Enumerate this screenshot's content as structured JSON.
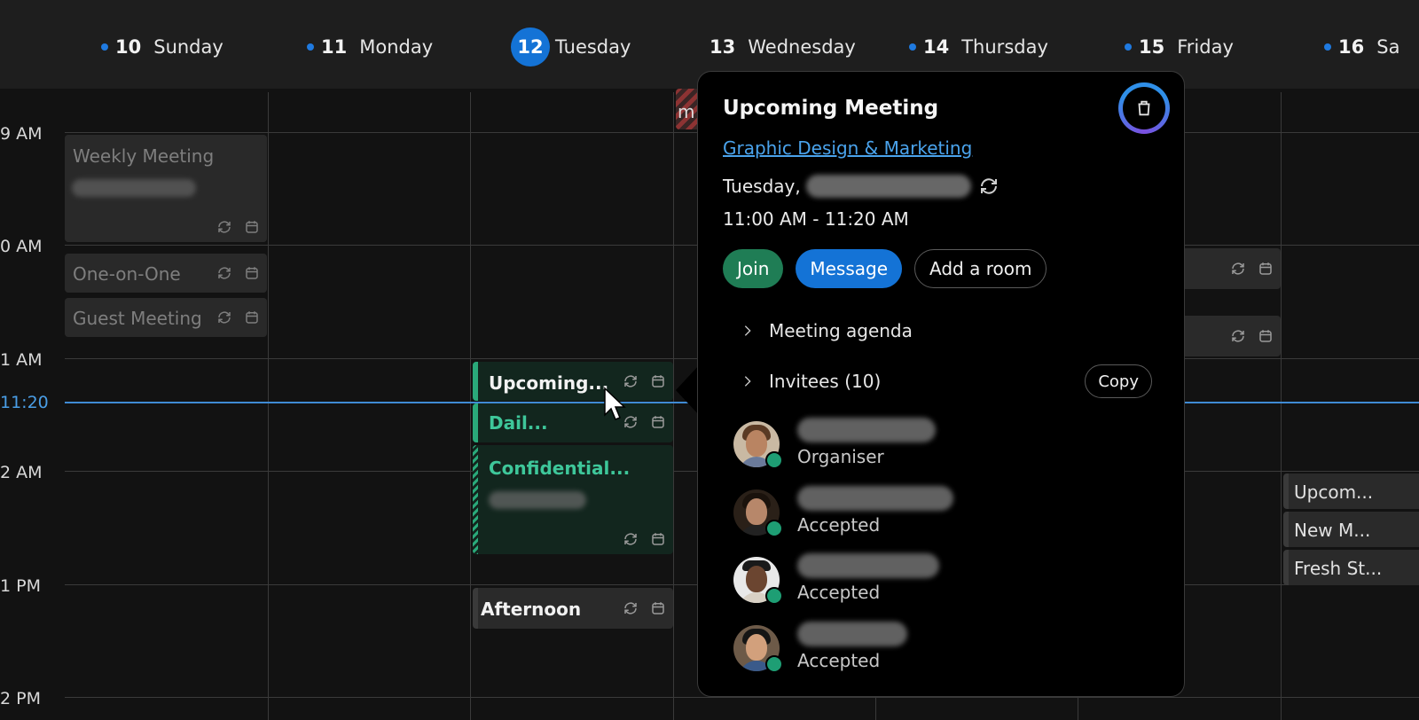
{
  "days": [
    {
      "num": "10",
      "name": "Sunday",
      "dot": true,
      "today": false
    },
    {
      "num": "11",
      "name": "Monday",
      "dot": true,
      "today": false
    },
    {
      "num": "12",
      "name": "Tuesday",
      "dot": false,
      "today": true
    },
    {
      "num": "13",
      "name": "Wednesday",
      "dot": false,
      "today": false
    },
    {
      "num": "14",
      "name": "Thursday",
      "dot": true,
      "today": false
    },
    {
      "num": "15",
      "name": "Friday",
      "dot": true,
      "today": false
    },
    {
      "num": "16",
      "name": "Sa",
      "dot": true,
      "today": false
    }
  ],
  "time_labels": [
    "9 AM",
    "0 AM",
    "1 AM",
    "2 AM",
    "1 PM",
    "2 PM"
  ],
  "now_label": "11:20",
  "events": {
    "weekly_meeting": "Weekly Meeting",
    "one_on_one": "One-on-One",
    "guest_meeting": "Guest Meeting",
    "upcoming_short": "Upcoming...",
    "daily_short": "Dail...",
    "confidential_short": "Confidential...",
    "afternoon": "Afternoon",
    "wed_stub": "m",
    "sat_upcoming": "Upcom...",
    "sat_new": "New M...",
    "sat_fresh": "Fresh St..."
  },
  "popup": {
    "title": "Upcoming Meeting",
    "group_link": "Graphic Design & Marketing",
    "date_prefix": "Tuesday,",
    "time_range": "11:00 AM - 11:20 AM",
    "join_label": "Join",
    "message_label": "Message",
    "add_room_label": "Add a room",
    "agenda_label": "Meeting agenda",
    "invitees_label": "Invitees (10)",
    "copy_label": "Copy",
    "invitees": [
      {
        "role": "Organiser"
      },
      {
        "role": "Accepted"
      },
      {
        "role": "Accepted"
      },
      {
        "role": "Accepted"
      }
    ]
  },
  "colors": {
    "accent_blue": "#1473d6",
    "join_green": "#1f7d55",
    "event_green": "#2aa97a",
    "link_blue": "#4aa3ec",
    "now_line": "#3f8bd4"
  }
}
